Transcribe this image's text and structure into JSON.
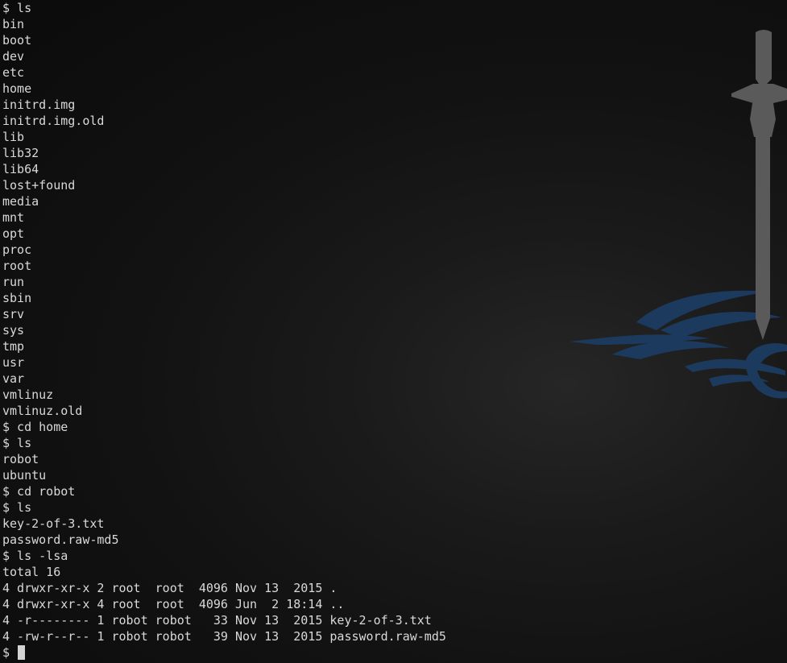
{
  "terminal": {
    "lines": [
      "$ ls",
      "bin",
      "boot",
      "dev",
      "etc",
      "home",
      "initrd.img",
      "initrd.img.old",
      "lib",
      "lib32",
      "lib64",
      "lost+found",
      "media",
      "mnt",
      "opt",
      "proc",
      "root",
      "run",
      "sbin",
      "srv",
      "sys",
      "tmp",
      "usr",
      "var",
      "vmlinuz",
      "vmlinuz.old",
      "$ cd home",
      "$ ls",
      "robot",
      "ubuntu",
      "$ cd robot",
      "$ ls",
      "key-2-of-3.txt",
      "password.raw-md5",
      "$ ls -lsa",
      "total 16",
      "4 drwxr-xr-x 2 root  root  4096 Nov 13  2015 .",
      "4 drwxr-xr-x 4 root  root  4096 Jun  2 18:14 ..",
      "4 -r-------- 1 robot robot   33 Nov 13  2015 key-2-of-3.txt",
      "4 -rw-r--r-- 1 robot robot   39 Nov 13  2015 password.raw-md5"
    ],
    "prompt": "$ "
  },
  "colors": {
    "background": "#121212",
    "text": "#d9d9d9",
    "sword": "#5a5a5a",
    "tribal": "#1c3a5e"
  },
  "icons": {
    "wallpaper_sword": "sword-icon",
    "wallpaper_tribal": "tribal-swirl-icon"
  }
}
